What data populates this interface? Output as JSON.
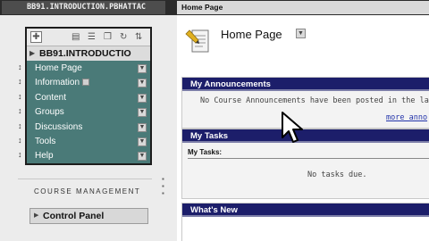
{
  "top_bar": {
    "course_id": "BB91.INTRODUCTION.PBHATTAC",
    "page": "Home Page"
  },
  "course_menu": {
    "title": "BB91.INTRODUCTIO",
    "toolbar_icons": [
      "add-icon",
      "folder-icon",
      "list-icon",
      "folder-view-icon",
      "refresh-icon",
      "collapse-arrows-icon"
    ],
    "items": [
      {
        "label": "Home Page"
      },
      {
        "label": "Information"
      },
      {
        "label": "Content"
      },
      {
        "label": "Groups"
      },
      {
        "label": "Discussions"
      },
      {
        "label": "Tools"
      },
      {
        "label": "Help"
      }
    ]
  },
  "course_management": {
    "heading": "COURSE MANAGEMENT",
    "control_panel": "Control Panel"
  },
  "main": {
    "page_title": "Home Page",
    "announcements": {
      "header": "My Announcements",
      "message": "No Course Announcements have been posted in the las",
      "more_link": "more anno"
    },
    "tasks": {
      "header": "My Tasks",
      "subheader": "My Tasks:",
      "message": "No tasks due."
    },
    "whats_new": {
      "header": "What's New"
    }
  },
  "colors": {
    "menu_background": "#4a7a78",
    "module_header": "#1c1e6a",
    "link": "#2233aa"
  }
}
